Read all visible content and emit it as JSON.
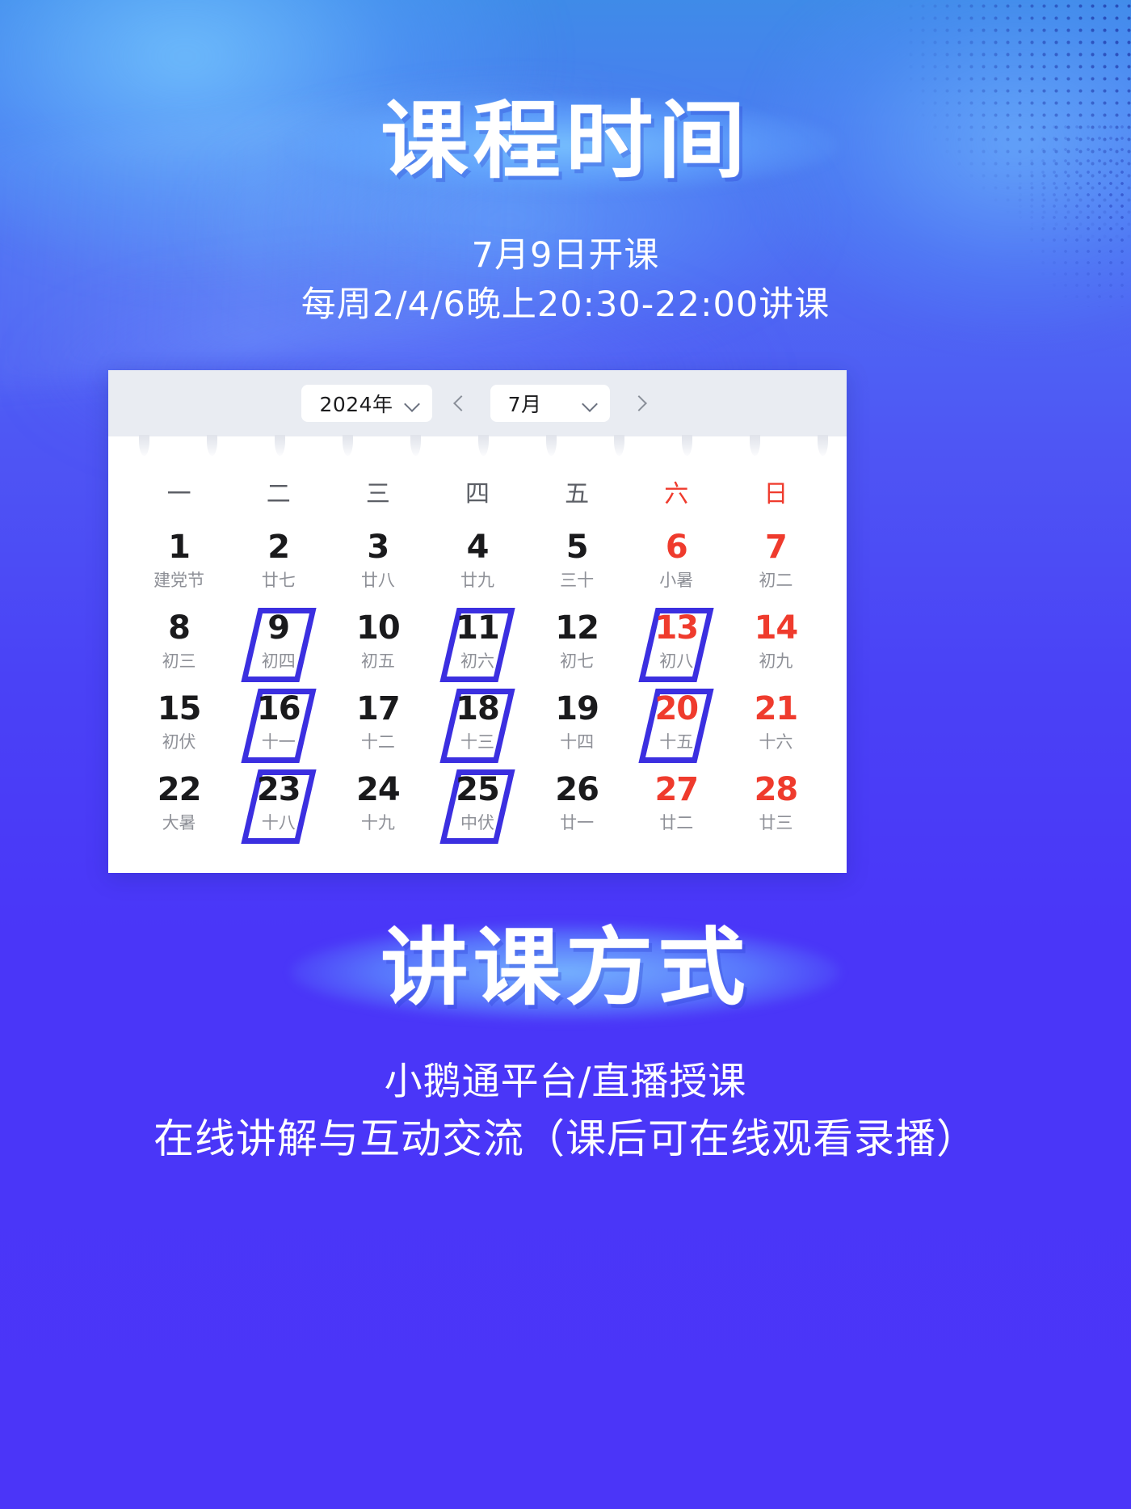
{
  "poster": {
    "section_1_title": "课程时间",
    "section_1_lines": [
      "7月9日开课",
      "每周2/4/6晚上20:30-22:00讲课"
    ],
    "section_2_title": "讲课方式",
    "section_2_lines": [
      "小鹅通平台/直播授课",
      "在线讲解与互动交流（课后可在线观看录播）"
    ],
    "accent_color": "#3b2fe0",
    "weekend_color": "#ef3b2d",
    "background_color": "#4a42f6"
  },
  "calendar": {
    "year_label": "2024年",
    "month_label": "7月",
    "prev_arrow": "‹",
    "next_arrow": "›",
    "year_chevron": "chevron-down-icon",
    "month_chevron": "chevron-down-icon",
    "weekdays": [
      {
        "label": "一",
        "weekend": false
      },
      {
        "label": "二",
        "weekend": false
      },
      {
        "label": "三",
        "weekend": false
      },
      {
        "label": "四",
        "weekend": false
      },
      {
        "label": "五",
        "weekend": false
      },
      {
        "label": "六",
        "weekend": true
      },
      {
        "label": "日",
        "weekend": true
      }
    ],
    "weeks": [
      [
        {
          "day": "1",
          "lunar": "建党节",
          "weekend": false,
          "marked": false
        },
        {
          "day": "2",
          "lunar": "廿七",
          "weekend": false,
          "marked": false
        },
        {
          "day": "3",
          "lunar": "廿八",
          "weekend": false,
          "marked": false
        },
        {
          "day": "4",
          "lunar": "廿九",
          "weekend": false,
          "marked": false
        },
        {
          "day": "5",
          "lunar": "三十",
          "weekend": false,
          "marked": false
        },
        {
          "day": "6",
          "lunar": "小暑",
          "weekend": true,
          "marked": false
        },
        {
          "day": "7",
          "lunar": "初二",
          "weekend": true,
          "marked": false
        }
      ],
      [
        {
          "day": "8",
          "lunar": "初三",
          "weekend": false,
          "marked": false
        },
        {
          "day": "9",
          "lunar": "初四",
          "weekend": false,
          "marked": true
        },
        {
          "day": "10",
          "lunar": "初五",
          "weekend": false,
          "marked": false
        },
        {
          "day": "11",
          "lunar": "初六",
          "weekend": false,
          "marked": true
        },
        {
          "day": "12",
          "lunar": "初七",
          "weekend": false,
          "marked": false
        },
        {
          "day": "13",
          "lunar": "初八",
          "weekend": true,
          "marked": true
        },
        {
          "day": "14",
          "lunar": "初九",
          "weekend": true,
          "marked": false
        }
      ],
      [
        {
          "day": "15",
          "lunar": "初伏",
          "weekend": false,
          "marked": false
        },
        {
          "day": "16",
          "lunar": "十一",
          "weekend": false,
          "marked": true
        },
        {
          "day": "17",
          "lunar": "十二",
          "weekend": false,
          "marked": false
        },
        {
          "day": "18",
          "lunar": "十三",
          "weekend": false,
          "marked": true
        },
        {
          "day": "19",
          "lunar": "十四",
          "weekend": false,
          "marked": false
        },
        {
          "day": "20",
          "lunar": "十五",
          "weekend": true,
          "marked": true
        },
        {
          "day": "21",
          "lunar": "十六",
          "weekend": true,
          "marked": false
        }
      ],
      [
        {
          "day": "22",
          "lunar": "大暑",
          "weekend": false,
          "marked": false
        },
        {
          "day": "23",
          "lunar": "十八",
          "weekend": false,
          "marked": true
        },
        {
          "day": "24",
          "lunar": "十九",
          "weekend": false,
          "marked": false
        },
        {
          "day": "25",
          "lunar": "中伏",
          "weekend": false,
          "marked": true
        },
        {
          "day": "26",
          "lunar": "廿一",
          "weekend": false,
          "marked": false
        },
        {
          "day": "27",
          "lunar": "廿二",
          "weekend": true,
          "marked": false
        },
        {
          "day": "28",
          "lunar": "廿三",
          "weekend": true,
          "marked": false
        }
      ]
    ]
  }
}
